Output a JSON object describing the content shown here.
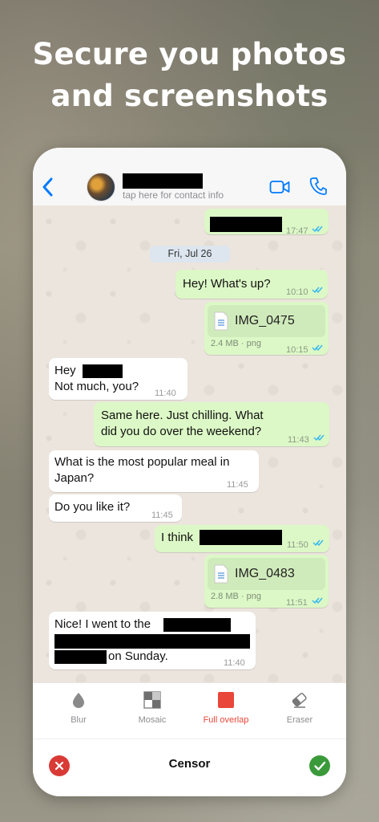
{
  "promo": {
    "headline_line1": "Secure you photos",
    "headline_line2": "and screenshots"
  },
  "header": {
    "contact_sub": "tap here for contact info",
    "back_icon": "chevron-left-icon",
    "video_icon": "video-camera-icon",
    "call_icon": "phone-icon",
    "accent": "#007aff"
  },
  "chat": {
    "date": "Fri, Jul 26",
    "messages": [
      {
        "dir": "out",
        "time": "17:47"
      },
      {
        "dir": "out",
        "text": "Hey! What's up?",
        "time": "10:10"
      },
      {
        "dir": "out",
        "file": "IMG_0475",
        "meta": "2.4 MB · png",
        "time": "10:15"
      },
      {
        "dir": "in",
        "text_a": "Hey",
        "text_b": "Not much, you?",
        "time": "11:40"
      },
      {
        "dir": "out",
        "text": "Same here. Just chilling. What did you do over the weekend?",
        "line1": "Same here. Just chilling. What",
        "line2": "did you do over the weekend?",
        "time": "11:43"
      },
      {
        "dir": "in",
        "line1": "What is the most popular meal in",
        "line2": "Japan?",
        "time": "11:45"
      },
      {
        "dir": "in",
        "text": "Do you like it?",
        "time": "11:45"
      },
      {
        "dir": "out",
        "text": "I think",
        "time": "11:50"
      },
      {
        "dir": "out",
        "file": "IMG_0483",
        "meta": "2.8 MB · png",
        "time": "11:51"
      },
      {
        "dir": "in",
        "text_a": "Nice! I went to the",
        "text_b": "on Sunday.",
        "time": "11:40"
      }
    ]
  },
  "toolbar": {
    "tools": [
      {
        "label": "Blur",
        "icon": "droplet-icon",
        "active": false
      },
      {
        "label": "Mosaic",
        "icon": "mosaic-icon",
        "active": false
      },
      {
        "label": "Full overlap",
        "icon": "square-fill-icon",
        "active": true
      },
      {
        "label": "Eraser",
        "icon": "eraser-icon",
        "active": false
      }
    ],
    "active_color": "#e8473a"
  },
  "bottom": {
    "title": "Censor",
    "cancel_icon": "close-icon",
    "confirm_icon": "check-icon"
  }
}
